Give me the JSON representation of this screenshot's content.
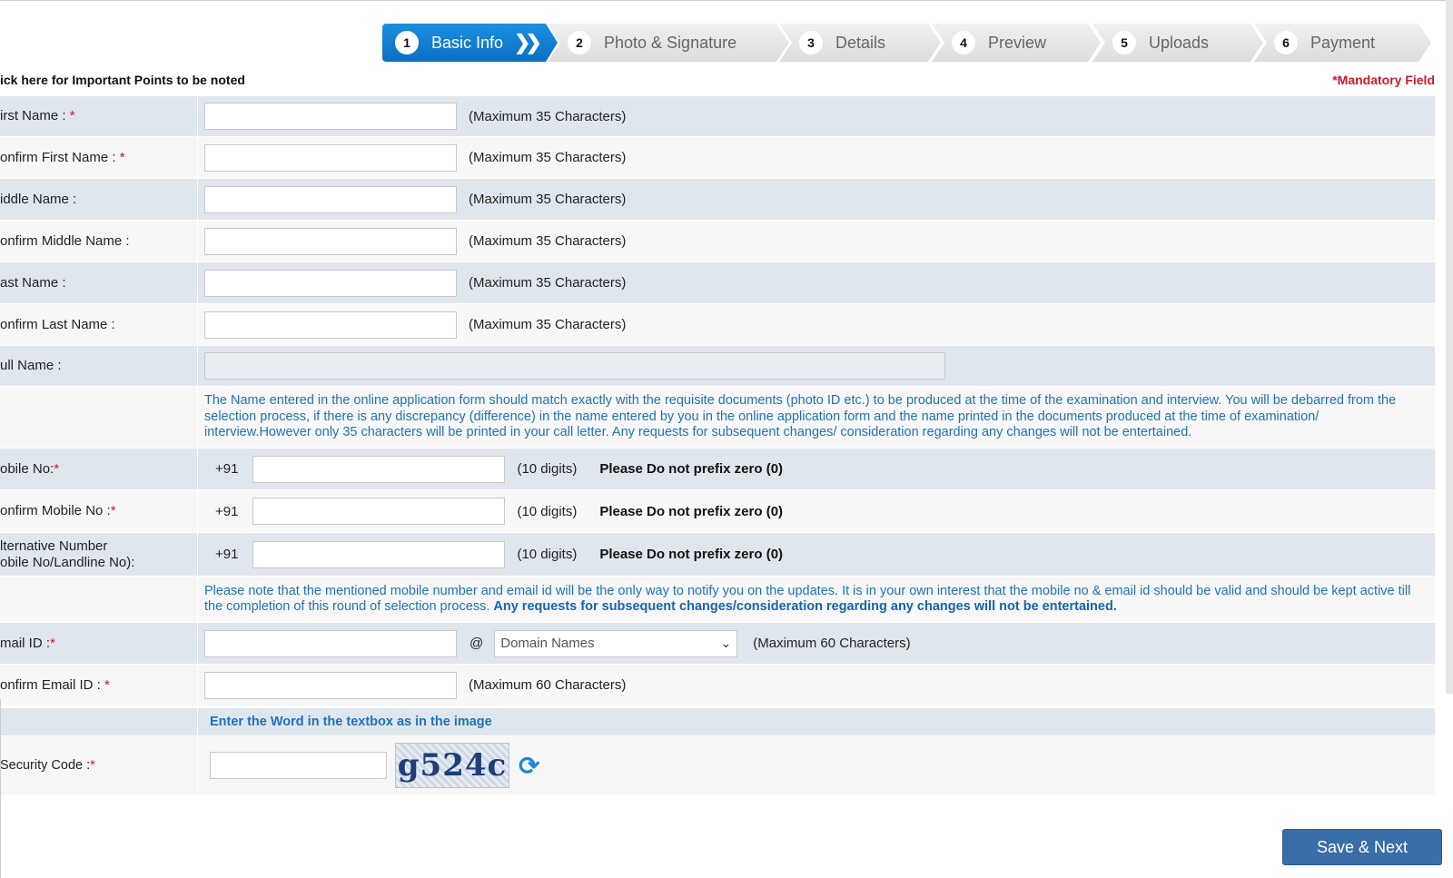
{
  "stepper": [
    {
      "num": "1",
      "label": "Basic Info"
    },
    {
      "num": "2",
      "label": "Photo & Signature"
    },
    {
      "num": "3",
      "label": "Details"
    },
    {
      "num": "4",
      "label": "Preview"
    },
    {
      "num": "5",
      "label": "Uploads"
    },
    {
      "num": "6",
      "label": "Payment"
    }
  ],
  "important_link": "ick here for Important Points to be noted",
  "mandatory_note": "*Mandatory Field",
  "fields": {
    "first_name": {
      "label": "irst Name : ",
      "star": "*",
      "hint": "(Maximum 35 Characters)"
    },
    "confirm_first_name": {
      "label": "onfirm First Name : ",
      "star": "*",
      "hint": "(Maximum 35 Characters)"
    },
    "middle_name": {
      "label": "iddle Name :",
      "hint": "(Maximum 35 Characters)"
    },
    "confirm_middle_name": {
      "label": "onfirm Middle Name :",
      "hint": "(Maximum 35 Characters)"
    },
    "last_name": {
      "label": "ast Name :",
      "hint": "(Maximum 35 Characters)"
    },
    "confirm_last_name": {
      "label": "onfirm Last Name :",
      "hint": "(Maximum 35 Characters)"
    },
    "full_name": {
      "label": "ull Name :"
    }
  },
  "name_note": "The Name entered in the online application form should match exactly with the requisite documents (photo ID etc.) to be produced at the time of the examination and interview. You will be debarred from the selection process, if there is any discrepancy (difference) in the name entered by you in the online application form and the name printed in the documents produced at the time of examination/ interview.However only 35 characters will be printed in your call letter. Any requests for subsequent changes/ consideration regarding any changes will not be entertained.",
  "mobile": {
    "label": "obile No:",
    "star": "*",
    "prefix": "+91",
    "hint": "(10 digits)",
    "note": "Please Do not prefix zero (0)"
  },
  "confirm_mobile": {
    "label": "onfirm Mobile No :",
    "star": "*",
    "prefix": "+91",
    "hint": "(10 digits)",
    "note": "Please Do not prefix zero (0)"
  },
  "alt_mobile": {
    "label_line1": "lternative Number",
    "label_line2": "obile No/Landline No):",
    "prefix": "+91",
    "hint": "(10 digits)",
    "note": "Please Do not prefix zero (0)"
  },
  "contact_note": "Please note that the mentioned mobile number and email id will be the only way to notify you on the updates. It is in your own interest that the mobile no & email id should be valid and should be kept active till the completion of this round of selection process. ",
  "contact_note_bold": "Any requests for subsequent changes/consideration regarding any changes will not be entertained.",
  "email": {
    "label": "mail ID :",
    "star": "*",
    "at": "@",
    "domain_selected": "Domain Names",
    "hint": "(Maximum 60 Characters)"
  },
  "confirm_email": {
    "label": "onfirm Email ID : ",
    "star": "*",
    "hint": "(Maximum 60 Characters)"
  },
  "security": {
    "heading": "Enter the Word in the textbox as in the image",
    "label": "Security Code :",
    "star": "*",
    "captcha_text": "g524c"
  },
  "save_button": "Save & Next"
}
